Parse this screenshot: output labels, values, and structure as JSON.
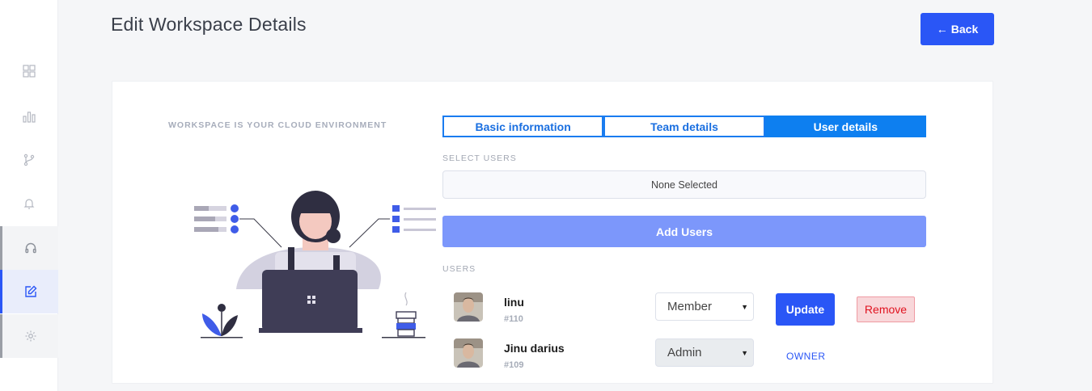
{
  "header": {
    "title": "Edit Workspace Details",
    "back_label": "Back",
    "back_icon": "arrow-left-icon"
  },
  "sidebar": {
    "items": [
      {
        "icon": "grid-icon"
      },
      {
        "icon": "bar-chart-icon"
      },
      {
        "icon": "git-branch-icon"
      },
      {
        "icon": "bell-icon"
      },
      {
        "icon": "headphones-icon"
      },
      {
        "icon": "edit-icon",
        "active": true
      },
      {
        "icon": "settings-icon"
      }
    ]
  },
  "left_panel": {
    "tagline": "WORKSPACE IS YOUR CLOUD ENVIRONMENT"
  },
  "tabs": [
    {
      "label": "Basic information",
      "active": false
    },
    {
      "label": "Team details",
      "active": false
    },
    {
      "label": "User details",
      "active": true
    }
  ],
  "select_users": {
    "label": "SELECT USERS",
    "value": "None Selected",
    "add_label": "Add Users"
  },
  "users_section": {
    "label": "USERS",
    "users": [
      {
        "name": "linu",
        "id": "#110",
        "role": "Member",
        "update_label": "Update",
        "remove_label": "Remove"
      },
      {
        "name": "Jinu darius",
        "id": "#109",
        "role": "Admin",
        "owner_label": "OWNER"
      }
    ]
  },
  "colors": {
    "primary": "#2a56f6",
    "tab_active": "#0d7ff0",
    "add_button": "#7c97fb",
    "remove_bg": "#f8d7da",
    "remove_text": "#e0121f"
  }
}
